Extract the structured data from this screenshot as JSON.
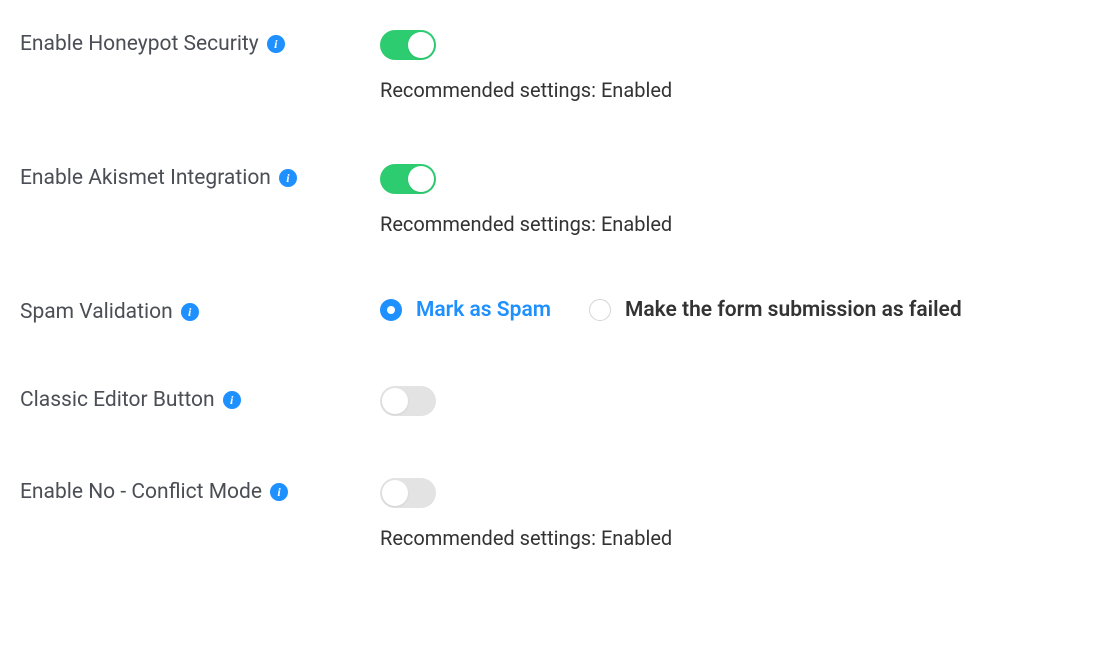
{
  "settings": {
    "honeypot": {
      "label": "Enable Honeypot Security",
      "helper": "Recommended settings: Enabled",
      "enabled": true
    },
    "akismet": {
      "label": "Enable Akismet Integration",
      "helper": "Recommended settings: Enabled",
      "enabled": true
    },
    "spam_validation": {
      "label": "Spam Validation",
      "options": {
        "mark_spam": "Mark as Spam",
        "make_failed": "Make the form submission as failed"
      },
      "selected": "mark_spam"
    },
    "classic_editor": {
      "label": "Classic Editor Button",
      "enabled": false
    },
    "no_conflict": {
      "label": "Enable No - Conflict Mode",
      "helper": "Recommended settings: Enabled",
      "enabled": false
    }
  },
  "colors": {
    "accent_blue": "#1e90ff",
    "toggle_green": "#2ecc71",
    "toggle_off_gray": "#e3e3e3",
    "text_dark": "#333333",
    "label_gray": "#4b4f55"
  }
}
